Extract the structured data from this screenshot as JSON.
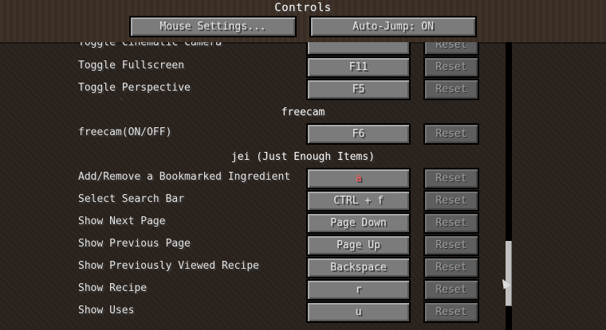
{
  "screen": {
    "title": "Controls",
    "mouse_settings": "Mouse Settings...",
    "auto_jump": "Auto-Jump: ON"
  },
  "bindings": [
    {
      "label": "Toggle Cinematic Camera",
      "key": "",
      "reset": "Reset"
    },
    {
      "label": "Toggle Fullscreen",
      "key": "F11",
      "reset": "Reset"
    },
    {
      "label": "Toggle Perspective",
      "key": "F5",
      "reset": "Reset"
    },
    {
      "category": "freecam"
    },
    {
      "label": "freecam(ON/OFF)",
      "key": "F6",
      "reset": "Reset"
    },
    {
      "category": "jei (Just Enough Items)"
    },
    {
      "label": "Add/Remove a Bookmarked Ingredient",
      "key": "a",
      "reset": "Reset",
      "conflict": true
    },
    {
      "label": "Select Search Bar",
      "key": "CTRL + f",
      "reset": "Reset"
    },
    {
      "label": "Show Next Page",
      "key": "Page Down",
      "reset": "Reset"
    },
    {
      "label": "Show Previous Page",
      "key": "Page Up",
      "reset": "Reset"
    },
    {
      "label": "Show Previously Viewed Recipe",
      "key": "Backspace",
      "reset": "Reset"
    },
    {
      "label": "Show Recipe",
      "key": "r",
      "reset": "Reset"
    },
    {
      "label": "Show Uses",
      "key": "u",
      "reset": "Reset"
    }
  ],
  "colors": {
    "conflict_key": "#ff5555"
  }
}
